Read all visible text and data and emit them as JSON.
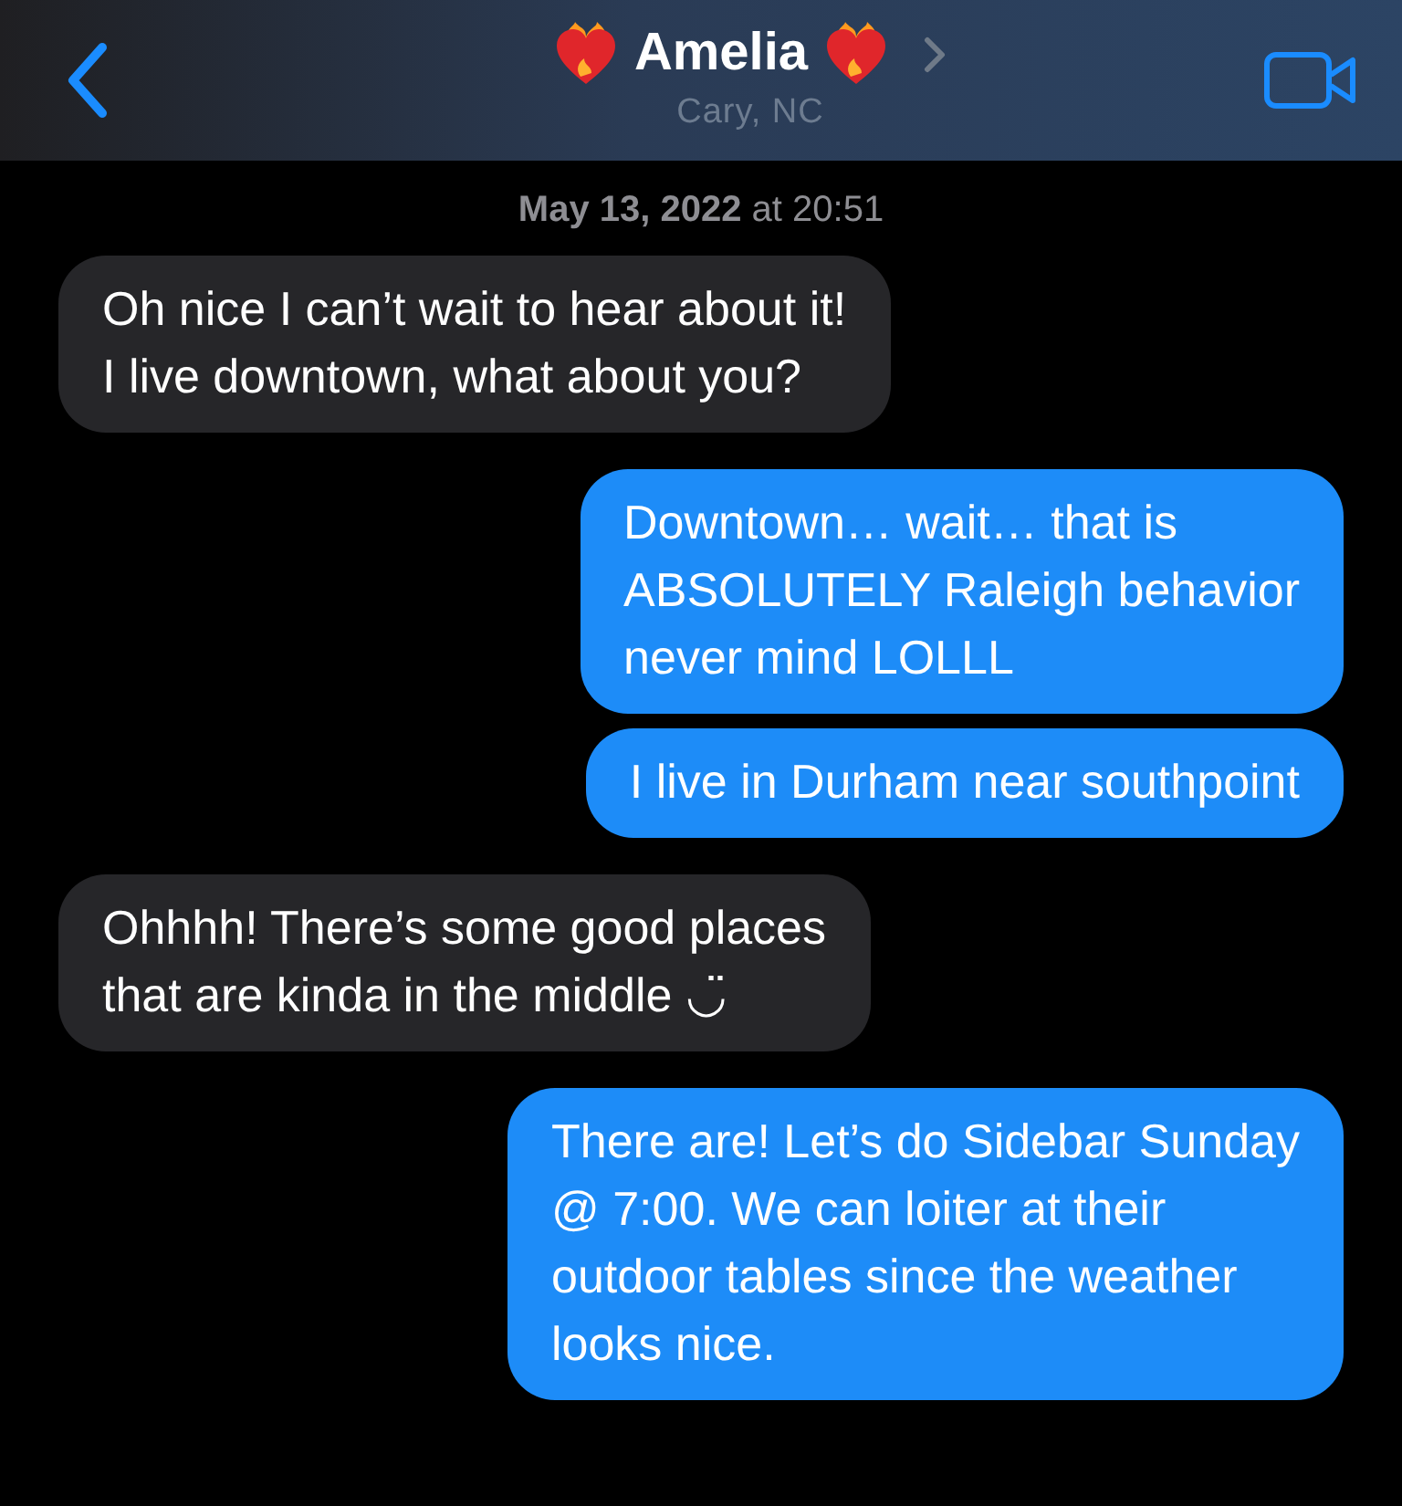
{
  "header": {
    "title": "Amelia",
    "subtitle": "Cary, NC"
  },
  "timestamp": "**May 13, 2022** at 20:51",
  "messages": [
    {
      "kind": "received",
      "text": "Oh nice I can’t wait to hear about it!\nI live downtown, what about you?"
    },
    {
      "kind": "sent",
      "text": "Downtown… wait… that is\nABSOLUTELY Raleigh behavior\nnever mind LOLLL"
    },
    {
      "kind": "sent",
      "text": "I live in Durham near southpoint"
    },
    {
      "kind": "received",
      "text": "Ohhhh! There’s some good places\nthat are kinda in the middle ◡̈"
    },
    {
      "kind": "sent",
      "text": "There are! Let’s do Sidebar Sunday\n@ 7:00. We can loiter at their\noutdoor tables since the weather\nlooks nice."
    }
  ]
}
